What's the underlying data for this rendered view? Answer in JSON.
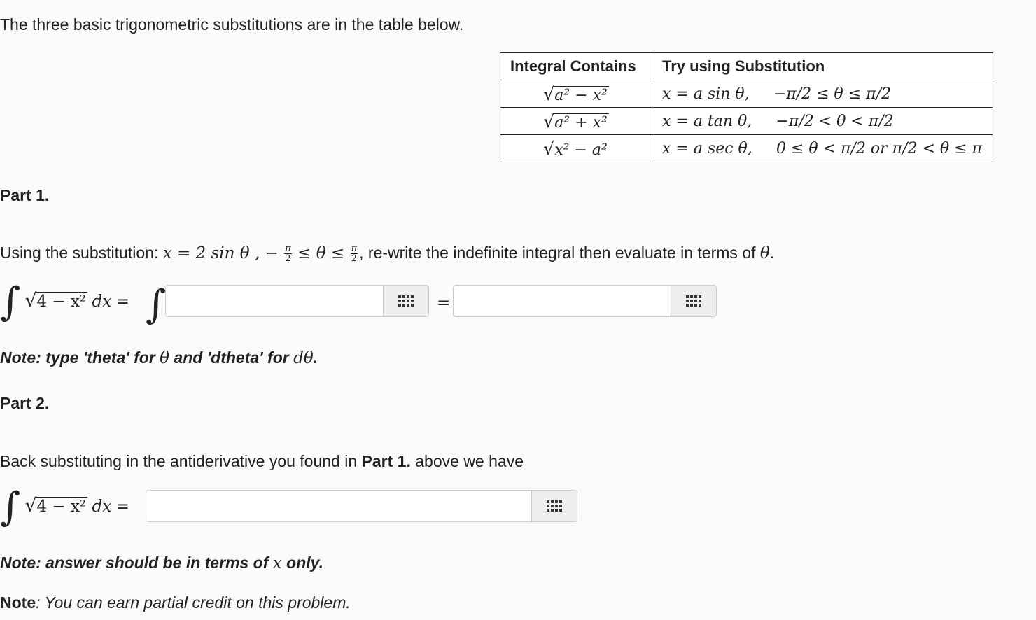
{
  "intro": "The three basic trigonometric substitutions are in the table below.",
  "table": {
    "headers": [
      "Integral Contains",
      "Try using Substitution"
    ],
    "rows": [
      {
        "radicand": "a² − x²",
        "sub": "x = a sin θ,",
        "range": "−π/2 ≤ θ ≤ π/2"
      },
      {
        "radicand": "a² + x²",
        "sub": "x = a tan θ,",
        "range": "−π/2 < θ < π/2"
      },
      {
        "radicand": "x² − a²",
        "sub": "x = a sec θ,",
        "range": "0 ≤ θ < π/2 or π/2 < θ ≤ π"
      }
    ]
  },
  "part1": {
    "heading": "Part 1.",
    "instruction_prefix": "Using the substitution: ",
    "substitution": "x = 2 sin θ , −",
    "range_mid": "≤ θ ≤",
    "instruction_suffix": ", re-write the indefinite integral then evaluate in terms of",
    "theta": "θ",
    "period": ".",
    "integral_lhs": "4 − x²",
    "dx": "dx",
    "equals": "=",
    "note_prefix": "Note: type 'theta' for",
    "note_theta": "θ",
    "note_mid": "and 'dtheta' for",
    "note_dtheta": "dθ",
    "note_end": "."
  },
  "part2": {
    "heading": "Part 2.",
    "text_prefix": "Back substituting in the antiderivative you found in ",
    "text_bold": "Part 1.",
    "text_suffix": " above we have",
    "integral_lhs": "4 − x²",
    "dx": "dx",
    "equals": "=",
    "note_prefix": "Note: answer should be in terms of",
    "note_x": "x",
    "note_end": "only."
  },
  "credit": {
    "bold": "Note",
    "text": ": You can earn partial credit on this problem."
  },
  "frac": {
    "num": "π",
    "den": "2"
  },
  "inputs": {
    "a1": "",
    "a2": "",
    "a3": ""
  }
}
